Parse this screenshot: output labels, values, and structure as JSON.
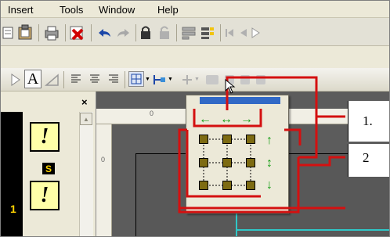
{
  "menu": {
    "items": [
      "Insert",
      "Tools",
      "Window",
      "Help"
    ]
  },
  "panel": {
    "close_label": "×",
    "badge_label": "S",
    "number_label": "1",
    "card_glyph": "!"
  },
  "callouts": {
    "label_1": "1.",
    "label_2": "2"
  },
  "ruler": {
    "h_tick": "0",
    "v_tick": "0"
  },
  "popup": {
    "alignment_arrows_row": [
      "←",
      "↔",
      "→"
    ],
    "alignment_arrows_col": [
      "↑",
      "↕",
      "↓"
    ]
  },
  "colors": {
    "accent": "#3169c6",
    "callout_red": "#d41010",
    "arrow_green": "#119c11",
    "badge_yellow": "#ffd400"
  },
  "icons": {
    "toolbar1": [
      "document-icon",
      "clipboard-icon",
      "printer-icon",
      "delete-icon",
      "undo-icon",
      "redo-icon",
      "lock-icon",
      "unlock-icon",
      "layout-icon",
      "layers-icon",
      "first-frame-icon",
      "previous-frame-icon",
      "play-icon"
    ],
    "toolbar2": [
      "pointer-icon",
      "text-tool-icon",
      "line-tool-icon",
      "align-left-icon",
      "align-center-icon",
      "align-right-icon",
      "grid-align-icon",
      "distribute-icon",
      "connector-icon"
    ]
  }
}
